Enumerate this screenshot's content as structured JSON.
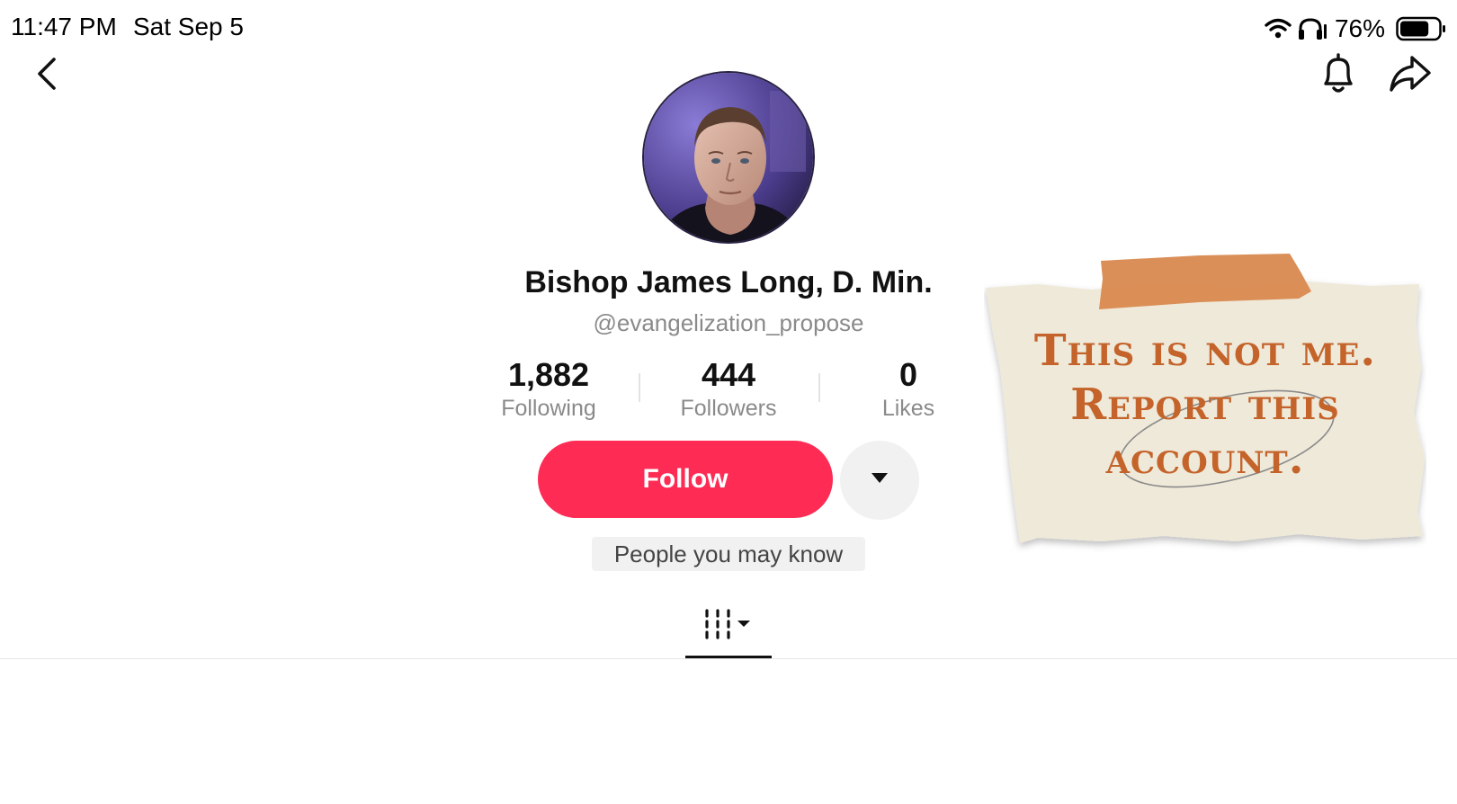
{
  "status_bar": {
    "time": "11:47 PM",
    "date": "Sat Sep 5",
    "battery_percent": "76%",
    "battery_level": 0.76,
    "icons": [
      "wifi-icon",
      "headphones-icon",
      "battery-icon"
    ]
  },
  "nav": {
    "icons": [
      "back-chevron-icon",
      "bell-icon",
      "share-arrow-icon"
    ]
  },
  "profile": {
    "display_name": "Bishop James Long, D. Min.",
    "handle": "@evangelization_propose",
    "stats": [
      {
        "value": "1,882",
        "label": "Following"
      },
      {
        "value": "444",
        "label": "Followers"
      },
      {
        "value": "0",
        "label": "Likes"
      }
    ],
    "follow_label": "Follow",
    "people_you_may_know": "People you may know"
  },
  "tabs": {
    "videos_tab_icon": "video-grid-icon"
  },
  "overlay_note": {
    "line1": "This is not me.",
    "line2": "Report this",
    "line3": "account."
  },
  "colors": {
    "accent": "#fe2c55",
    "note_text": "#c4632a",
    "note_paper": "#efe9d9",
    "tape": "#d9894f"
  }
}
